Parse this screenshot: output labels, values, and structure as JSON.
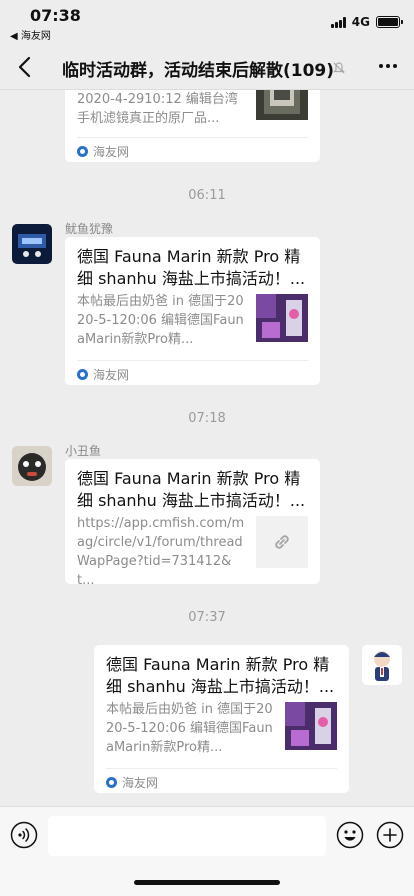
{
  "status": {
    "time": "07:38",
    "back_app": "◀ 海友网",
    "network": "4G",
    "battery_level": 1.0
  },
  "nav": {
    "title": "临时活动群，活动结束后解散(109)",
    "icons": [
      "back-chevron-icon",
      "mute-bell-icon",
      "more-icon"
    ]
  },
  "messages": [
    {
      "type": "card-partial",
      "desc": "2020-4-2910:12 编辑台湾手机滤镜真正的原厂品...",
      "source": "海友网"
    },
    {
      "type": "time",
      "text": "06:11"
    },
    {
      "type": "card",
      "sender": "鱿鱼犹豫",
      "title": "德国 Fauna Marin 新款 Pro 精细 shanhu 海盐上市搞活动！...",
      "desc": "本帖最后由奶爸 in 德国于2020-5-120:06 编辑德国FaunaMarin新款Pro精...",
      "source": "海友网"
    },
    {
      "type": "time",
      "text": "07:18"
    },
    {
      "type": "card",
      "sender": "小丑鱼",
      "title": "德国 Fauna Marin 新款 Pro 精细 shanhu 海盐上市搞活动！...",
      "desc": "https://app.cmfish.com/mag/circle/v1/forum/threadWapPage?tid=731412&t...",
      "source": ""
    },
    {
      "type": "time",
      "text": "07:37"
    },
    {
      "type": "card-self",
      "sender": "",
      "title": "德国 Fauna Marin 新款 Pro 精细 shanhu 海盐上市搞活动！...",
      "desc": "本帖最后由奶爸 in 德国于2020-5-120:06 编辑德国FaunaMarin新款Pro精...",
      "source": "海友网"
    }
  ],
  "input_bar": {
    "icons": [
      "voice-icon",
      "emoji-icon",
      "plus-icon"
    ]
  },
  "colors": {
    "background": "#EDEDED",
    "card": "#FFFFFF",
    "muted_text": "#8C8C8C",
    "source_icon": "#2A6FC9"
  }
}
